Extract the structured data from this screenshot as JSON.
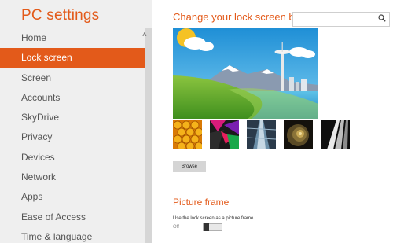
{
  "sidebar": {
    "title": "PC settings",
    "items": [
      {
        "label": "Home"
      },
      {
        "label": "Lock screen"
      },
      {
        "label": "Screen"
      },
      {
        "label": "Accounts"
      },
      {
        "label": "SkyDrive"
      },
      {
        "label": "Privacy"
      },
      {
        "label": "Devices"
      },
      {
        "label": "Network"
      },
      {
        "label": "Apps"
      },
      {
        "label": "Ease of Access"
      },
      {
        "label": "Time & language"
      }
    ],
    "selected_item": "Lock screen"
  },
  "main": {
    "title": "Change your lock screen background",
    "search_icon": "search-icon",
    "browse_label": "Browse",
    "picture_frame": {
      "title": "Picture frame",
      "description": "Use the lock screen as a picture frame",
      "state": "Off"
    }
  },
  "colors": {
    "accent": "#e35a1a",
    "sidebar_bg": "#efefef"
  }
}
